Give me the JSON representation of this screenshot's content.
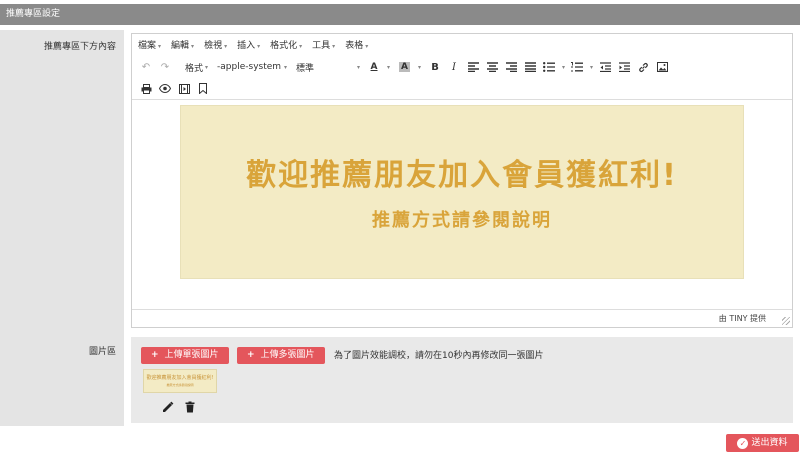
{
  "header": {
    "title": "推薦專區設定"
  },
  "editor_section": {
    "label": "推薦專區下方內容",
    "menus": [
      "檔案",
      "編輯",
      "檢視",
      "插入",
      "格式化",
      "工具",
      "表格"
    ],
    "toolbar": {
      "format_label": "格式",
      "font_family": "-apple-system",
      "font_size": "標準",
      "font_color_label": "A",
      "bg_color_label": "A",
      "bold_label": "B",
      "italic_label": "I"
    },
    "banner": {
      "headline": "歡迎推薦朋友加入會員獲紅利!",
      "subline": "推薦方式請參閱說明"
    },
    "status": "由 TINY 提供"
  },
  "image_section": {
    "label": "圖片區",
    "upload_single_label": "上傳單張圖片",
    "upload_multi_label": "上傳多張圖片",
    "note": "為了圖片效能調校，請勿在10秒內再修改同一張圖片",
    "thumb_text_1": "歡迎推薦朋友加入會員獲紅利!",
    "thumb_text_2": "推薦方式請參閱說明"
  },
  "footer": {
    "submit_label": "送出資料"
  },
  "colors": {
    "accent": "#e4565c",
    "banner_bg": "#f3ebc5",
    "banner_text": "#d9a43a",
    "header_bg": "#8a8a8a"
  }
}
